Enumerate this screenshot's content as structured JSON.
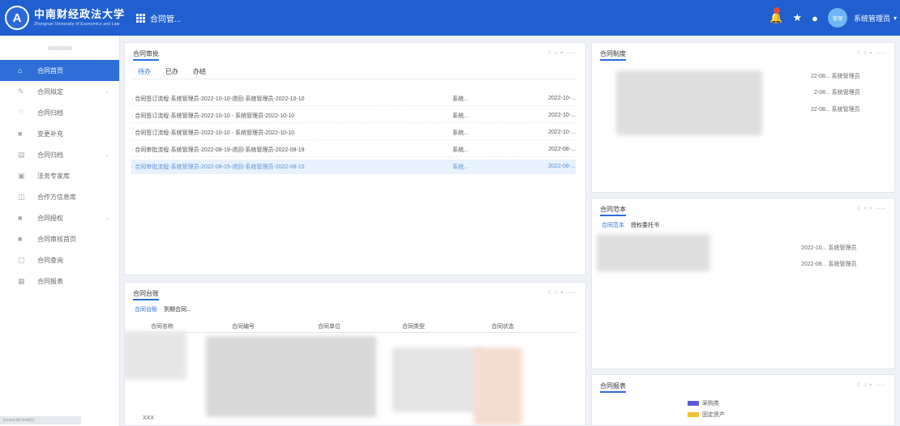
{
  "header": {
    "logo_text": "中南财经政法大学",
    "logo_en": "Zhongnan University of Economics and Law",
    "apps_label": "合同管...",
    "user_name": "系统管理员",
    "avatar_text": "管理"
  },
  "sidebar": {
    "items": [
      {
        "label": "合同首页",
        "icon": "home-icon",
        "active": true,
        "arrow": false
      },
      {
        "label": "合同拟定",
        "icon": "edit-icon",
        "active": false,
        "arrow": true
      },
      {
        "label": "合同归档",
        "icon": "archive-icon",
        "active": false,
        "arrow": false
      },
      {
        "label": "变更补充",
        "icon": "change-icon",
        "active": false,
        "arrow": false
      },
      {
        "label": "合同归档",
        "icon": "folder-icon",
        "active": false,
        "arrow": true
      },
      {
        "label": "法务专家库",
        "icon": "expert-icon",
        "active": false,
        "arrow": false
      },
      {
        "label": "合作方信息库",
        "icon": "partner-icon",
        "active": false,
        "arrow": false
      },
      {
        "label": "合同授权",
        "icon": "authorize-icon",
        "active": false,
        "arrow": true
      },
      {
        "label": "合同审核首页",
        "icon": "review-icon",
        "active": false,
        "arrow": false
      },
      {
        "label": "合同查询",
        "icon": "query-icon",
        "active": false,
        "arrow": false
      },
      {
        "label": "合同报表",
        "icon": "report-icon",
        "active": false,
        "arrow": false
      }
    ],
    "footer": "javascript:void(0);"
  },
  "approval": {
    "title": "合同审批",
    "tabs": [
      "待办",
      "已办",
      "办结"
    ],
    "rows": [
      {
        "title": "· 合同签订流程-系统管理员-2022-10-10-退回-系统管理员-2022-10-10",
        "sys": "系统...",
        "date": "2022-10-..."
      },
      {
        "title": "· 合同签订流程-系统管理员-2022-10-10 - 系统管理员-2022-10-10",
        "sys": "系统...",
        "date": "2022-10-..."
      },
      {
        "title": "· 合同签订流程-系统管理员-2022-10-10 - 系统管理员-2022-10-10",
        "sys": "系统...",
        "date": "2022-10-..."
      },
      {
        "title": "· 合同审批流程-系统管理员-2022-08-19-退回-系统管理员-2022-08-19",
        "sys": "系统...",
        "date": "2022-08-..."
      },
      {
        "title": "· 合同审批流程-系统管理员-2022-08-15-退回-系统管理员-2022-08-15",
        "sys": "系统...",
        "date": "2022-08-..."
      }
    ]
  },
  "regulations": {
    "title": "合同制度",
    "rows": [
      {
        "text": "22-08... 系统管理员"
      },
      {
        "text": "2-08... 系统管理员"
      },
      {
        "text": "22-08... 系统管理员"
      }
    ]
  },
  "templates": {
    "title": "合同范本",
    "tabs": [
      "合同范本",
      "授权委托书"
    ],
    "rows": [
      {
        "text": "2022-10... 系统管理员"
      },
      {
        "text": "2022-08... 系统管理员"
      }
    ]
  },
  "ledger": {
    "title": "合同台账",
    "tabs": [
      "合同台账",
      "到期合同..."
    ],
    "columns": [
      "合同名称",
      "合同编号",
      "合同单位",
      "合同类型",
      "合同状态"
    ],
    "bottom_text": "XXX"
  },
  "report": {
    "title": "合同报表",
    "legend": [
      {
        "label": "采购类",
        "color": "#5b5bd6"
      },
      {
        "label": "固定资产",
        "color": "#f1c232"
      }
    ]
  },
  "panel_tools": "C ≡ ▾ ——"
}
